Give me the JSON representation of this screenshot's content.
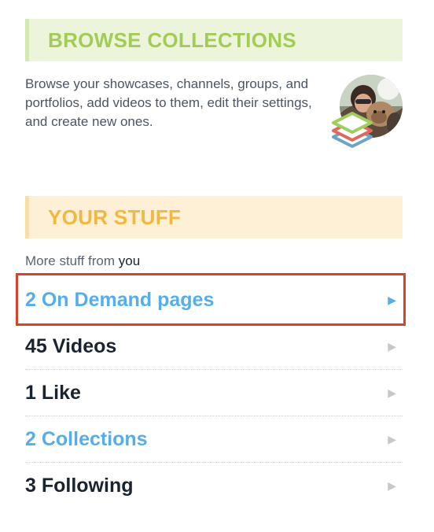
{
  "browse": {
    "title": "BROWSE COLLECTIONS",
    "description": "Browse your showcases, channels, groups, and portfolios, add videos to them, edit their settings, and create new ones.",
    "avatar_icon": "user-avatar-photo",
    "collections_icon": "layers-stack-icon"
  },
  "stuff": {
    "title": "YOUR STUFF",
    "subtitle_prefix": "More stuff from",
    "subtitle_user": "you",
    "items": [
      {
        "label": "2 On Demand pages",
        "linked": true,
        "selected": true,
        "arrow": "▶"
      },
      {
        "label": "45 Videos",
        "linked": false,
        "selected": false,
        "arrow": "▶"
      },
      {
        "label": "1 Like",
        "linked": false,
        "selected": false,
        "arrow": "▶"
      },
      {
        "label": "2 Collections",
        "linked": true,
        "selected": false,
        "arrow": "▶"
      },
      {
        "label": "3 Following",
        "linked": false,
        "selected": false,
        "arrow": "▶"
      }
    ]
  },
  "colors": {
    "browse_accent": "#a3cc55",
    "stuff_accent": "#f0b83e",
    "link": "#55aeea",
    "highlight": "#d9432a"
  }
}
